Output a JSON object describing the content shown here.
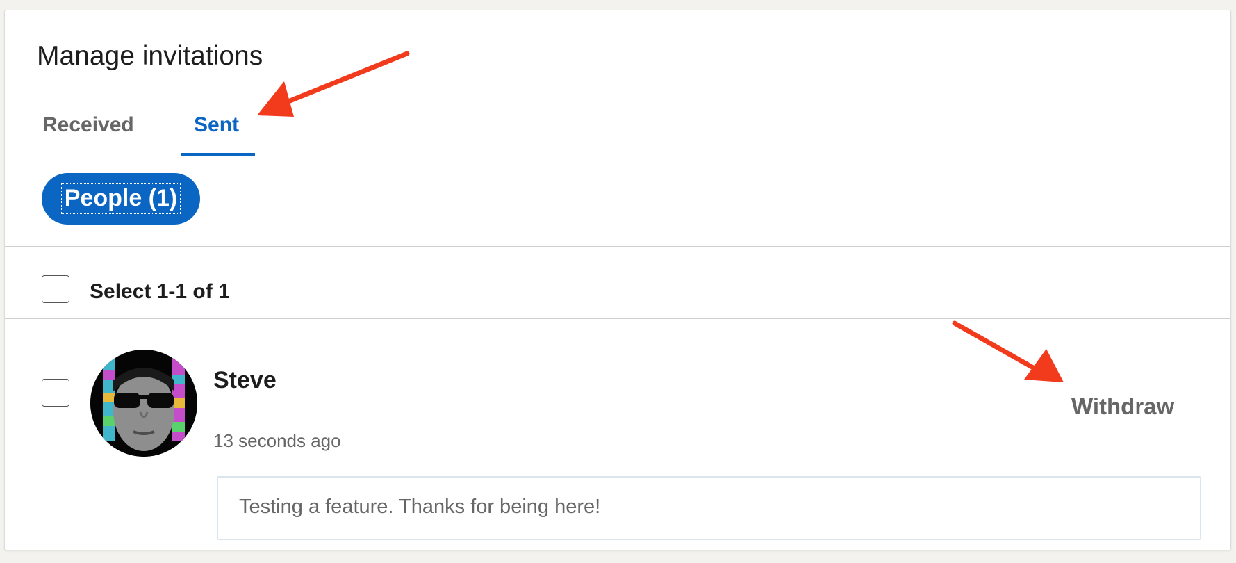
{
  "header": {
    "title": "Manage invitations"
  },
  "tabs": [
    {
      "label": "Received",
      "active": false
    },
    {
      "label": "Sent",
      "active": true
    }
  ],
  "filter": {
    "pill_label": "People (1)"
  },
  "selection": {
    "label": "Select 1-1 of 1",
    "checked": false
  },
  "invitations": [
    {
      "name": "Steve",
      "time": "13 seconds ago",
      "message": "Testing a feature. Thanks for being here!",
      "action_label": "Withdraw",
      "checked": false
    }
  ],
  "colors": {
    "accent": "#0a66c2",
    "annotation_arrow": "#f23a1d",
    "muted_text": "#666666"
  },
  "icons": {
    "annotation": "red-arrow-icon"
  }
}
